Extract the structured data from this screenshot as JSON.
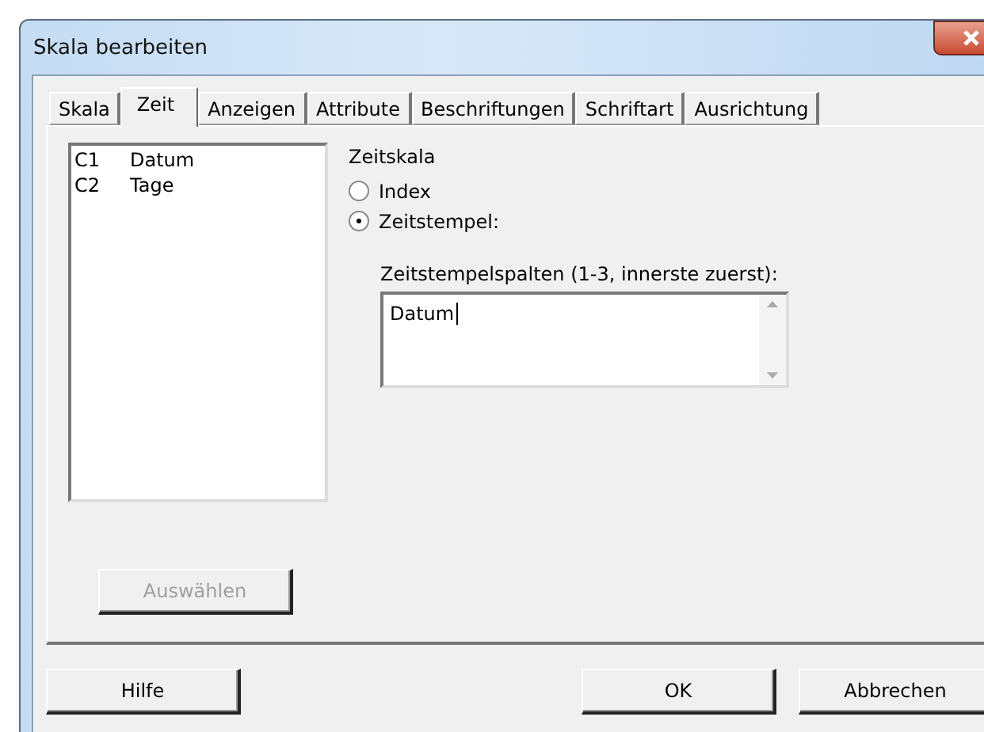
{
  "window": {
    "title": "Skala bearbeiten"
  },
  "tabs": [
    {
      "label": "Skala",
      "selected": false
    },
    {
      "label": "Zeit",
      "selected": true
    },
    {
      "label": "Anzeigen",
      "selected": false
    },
    {
      "label": "Attribute",
      "selected": false
    },
    {
      "label": "Beschriftungen",
      "selected": false
    },
    {
      "label": "Schriftart",
      "selected": false
    },
    {
      "label": "Ausrichtung",
      "selected": false
    }
  ],
  "column_list": [
    {
      "id": "C1",
      "name": "Datum"
    },
    {
      "id": "C2",
      "name": "Tage"
    }
  ],
  "select_button": {
    "label": "Auswählen",
    "disabled": true
  },
  "time_scale": {
    "title": "Zeitskala",
    "options": [
      {
        "label": "Index",
        "selected": false
      },
      {
        "label": "Zeitstempel:",
        "selected": true
      }
    ],
    "columns_label": "Zeitstempelspalten (1-3, innerste zuerst):",
    "columns_value": "Datum"
  },
  "buttons": [
    "Hilfe",
    "OK",
    "Abbrechen"
  ]
}
